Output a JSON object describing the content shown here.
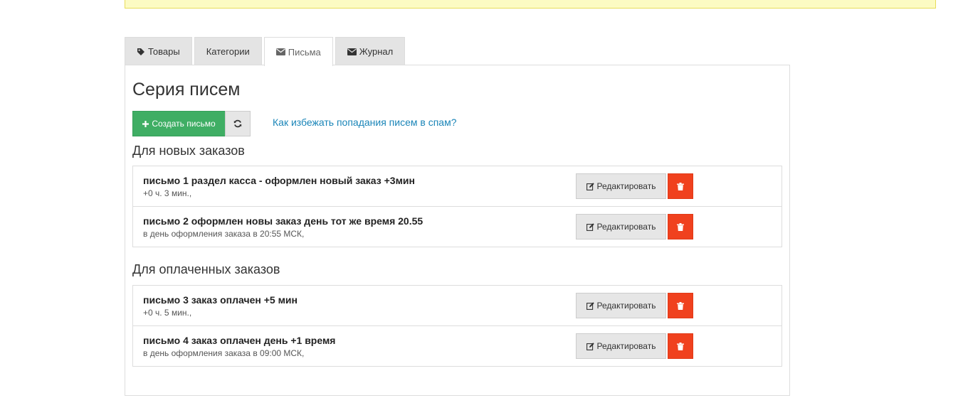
{
  "tabs": [
    {
      "label": "Товары",
      "icon": "tag-icon",
      "active": false
    },
    {
      "label": "Категории",
      "icon": "",
      "active": false
    },
    {
      "label": "Письма",
      "icon": "envelope-icon",
      "active": true
    },
    {
      "label": "Журнал",
      "icon": "envelope-icon",
      "active": false
    }
  ],
  "page": {
    "title": "Серия писем",
    "create_button": "Создать письмо",
    "spam_link": "Как избежать попадания писем в спам?"
  },
  "colors": {
    "create_button": "#3fae64",
    "delete_button": "#f0411e",
    "link": "#1a85b8",
    "notice": "#fcfbc3"
  },
  "sections": [
    {
      "title": "Для новых заказов",
      "items": [
        {
          "title": "письмо 1 раздел касса - оформлен новый заказ +3мин",
          "subtitle": "+0 ч. 3 мин.,",
          "edit_label": "Редактировать"
        },
        {
          "title": "письмо 2 оформлен новы заказ день тот же время 20.55",
          "subtitle": "в день оформления заказа в 20:55 МСК,",
          "edit_label": "Редактировать"
        }
      ]
    },
    {
      "title": "Для оплаченных заказов",
      "items": [
        {
          "title": "письмо 3 заказ оплачен +5 мин",
          "subtitle": "+0 ч. 5 мин.,",
          "edit_label": "Редактировать"
        },
        {
          "title": "письмо 4 заказ оплачен день +1 время",
          "subtitle": "в день оформления заказа в 09:00 МСК,",
          "edit_label": "Редактировать"
        }
      ]
    }
  ]
}
